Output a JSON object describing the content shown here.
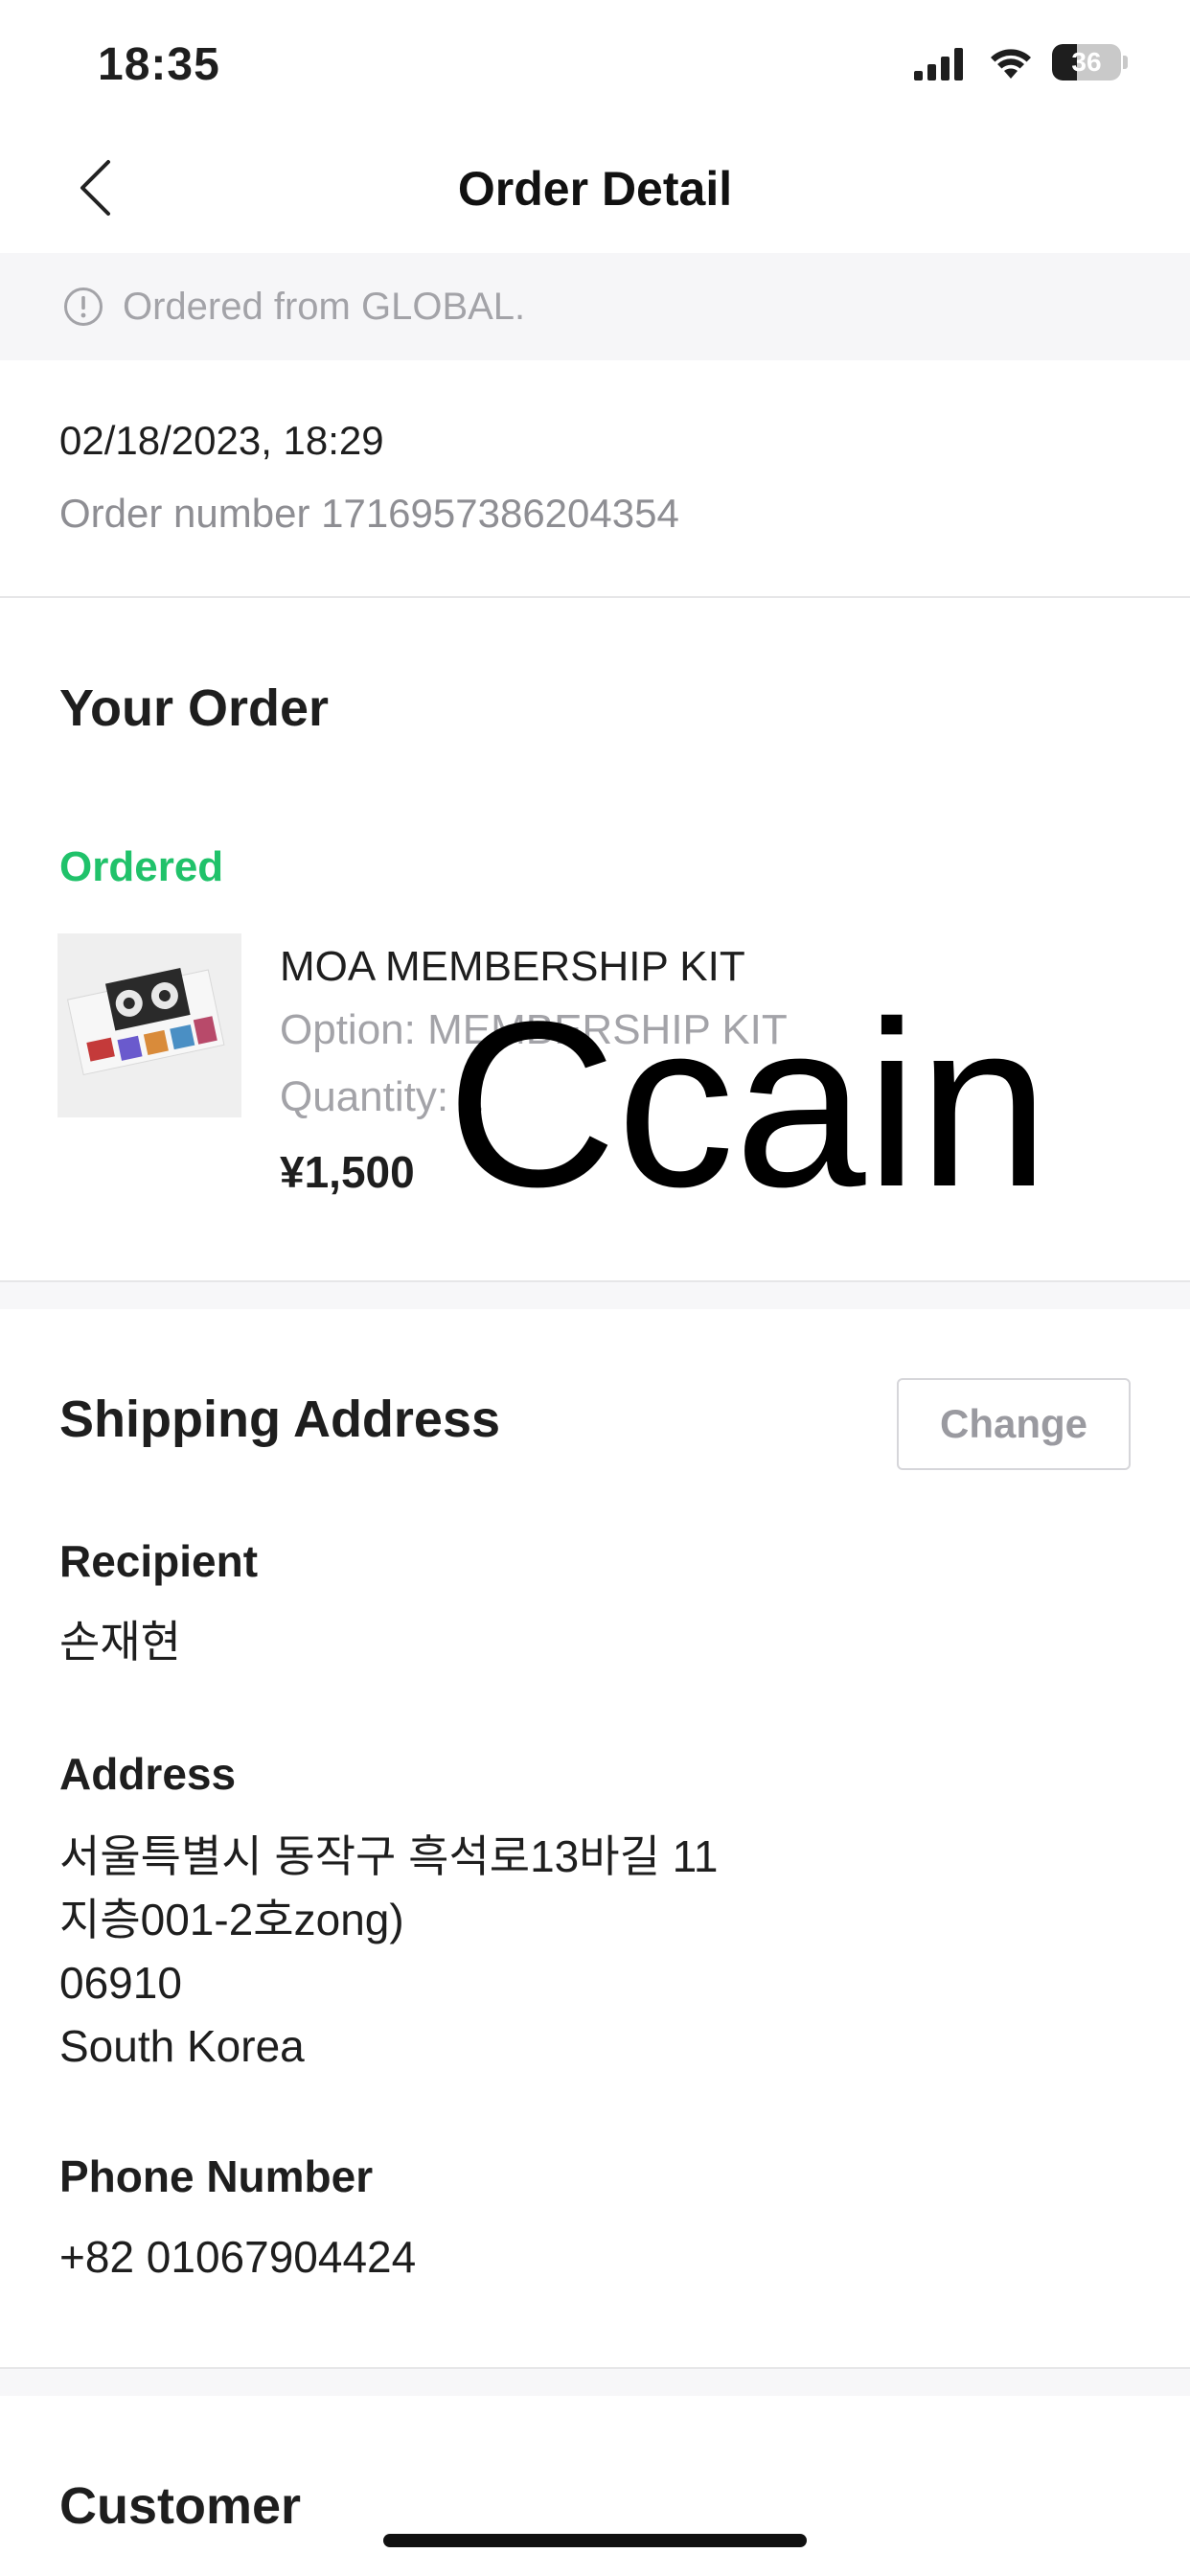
{
  "status_bar": {
    "time": "18:35",
    "battery_level": 36,
    "battery_label": "36"
  },
  "nav": {
    "title": "Order Detail",
    "back_icon": "chevron-left-icon"
  },
  "notice": {
    "icon": "info-circle-icon",
    "text": "Ordered from GLOBAL."
  },
  "order_meta": {
    "date": "02/18/2023, 18:29",
    "order_number": "Order number 1716957386204354"
  },
  "your_order": {
    "title": "Your Order",
    "status": "Ordered",
    "status_color": "#20c26a",
    "item": {
      "name": "MOA MEMBERSHIP KIT",
      "option": "Option: MEMBERSHIP KIT",
      "quantity": "Quantity: 1",
      "price": "¥1,500"
    }
  },
  "overlay_text": "Ccain",
  "shipping": {
    "title": "Shipping Address",
    "change_label": "Change",
    "recipient_label": "Recipient",
    "recipient_value": "손재현",
    "address_label": "Address",
    "address_lines": [
      "서울특별시 동작구 흑석로13바길 11",
      "지층001-2호zong)",
      "06910",
      "South Korea"
    ],
    "phone_label": "Phone Number",
    "phone_value": "+82 01067904424"
  },
  "customer": {
    "title": "Customer"
  }
}
